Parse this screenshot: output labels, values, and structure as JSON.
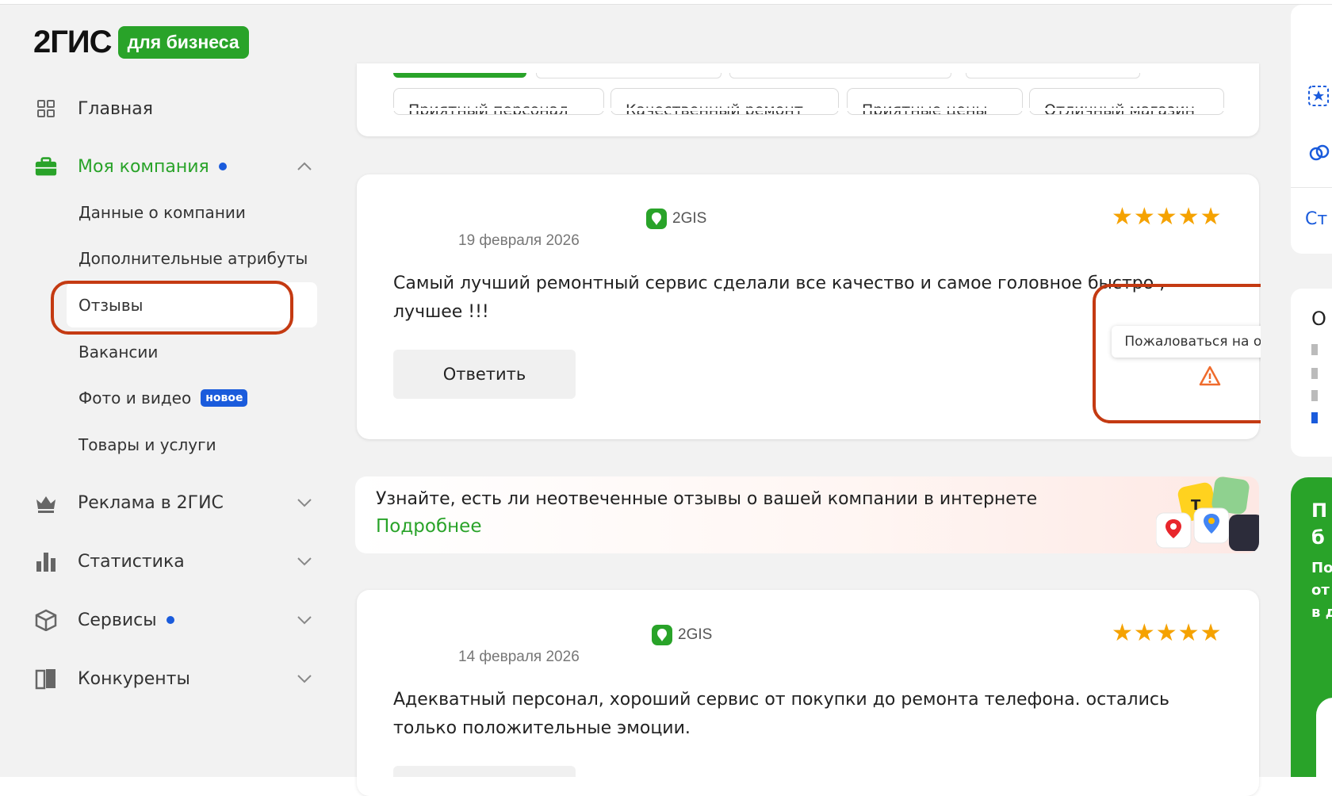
{
  "logo": {
    "brand": "2ГИС",
    "badge": "для бизнеса"
  },
  "sidebar": {
    "home": "Главная",
    "company": "Моя компания",
    "company_items": [
      {
        "label": "Данные о компании"
      },
      {
        "label": "Дополнительные атрибуты"
      },
      {
        "label": "Отзывы"
      },
      {
        "label": "Вакансии"
      },
      {
        "label": "Фото и видео",
        "badge": "новое"
      },
      {
        "label": "Товары и услуги"
      }
    ],
    "ads": "Реклама в 2ГИС",
    "stats": "Статистика",
    "services": "Сервисы",
    "competitors": "Конкуренты"
  },
  "filters": {
    "chips": [
      "Приятный персонал",
      "Качественный ремонт",
      "Приятные цены",
      "Отличный магазин"
    ]
  },
  "reviews": [
    {
      "source": "2GIS",
      "date": "19 февраля 2026",
      "stars": "★★★★★",
      "line1": "Самый лучший ремонтный сервис сделали все качество и самое головное быстро ,",
      "line2": "лучшее !!!",
      "reply": "Ответить"
    },
    {
      "source": "2GIS",
      "date": "14 февраля 2026",
      "stars": "★★★★★",
      "line1": "Адекватный персонал, хороший сервис от покупки до ремонта телефона. остались",
      "line2": "только положительные эмоции."
    }
  ],
  "tooltip": "Пожаловаться на отзыв",
  "banner": {
    "text": "Узнайте, есть ли неотвеченные отзывы о вашей компании в интернете",
    "link": "Подробнее"
  },
  "right_panel": {
    "link_fragment": "Ст",
    "card_fragment": "О",
    "green_title_1": "П",
    "green_title_2": "б",
    "green_text_1": "По",
    "green_text_2": "от",
    "green_text_3": "в д"
  },
  "colors": {
    "brand_green": "#29a329",
    "star": "#f5a200",
    "accent_blue": "#1a5bdc",
    "highlight_red": "#c43a12"
  }
}
